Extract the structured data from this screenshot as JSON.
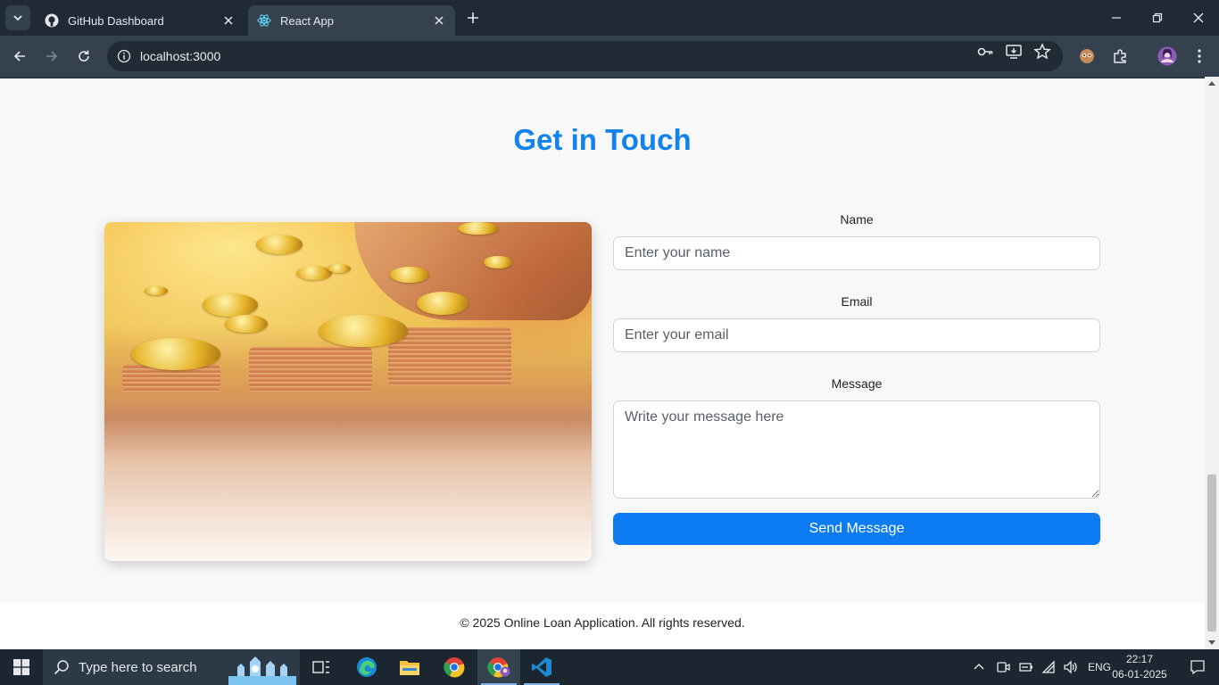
{
  "browser": {
    "tabs": [
      {
        "title": "GitHub Dashboard",
        "favicon": "github-icon"
      },
      {
        "title": "React App",
        "favicon": "react-icon"
      }
    ],
    "url": "localhost:3000"
  },
  "page": {
    "heading": "Get in Touch",
    "image": "coins-stack-photo",
    "form": {
      "name_label": "Name",
      "name_placeholder": "Enter your name",
      "email_label": "Email",
      "email_placeholder": "Enter your email",
      "message_label": "Message",
      "message_placeholder": "Write your message here",
      "submit_label": "Send Message"
    },
    "footer": "© 2025 Online Loan Application. All rights reserved."
  },
  "colors": {
    "accent": "#0d7cf2",
    "heading": "#1283ea",
    "chrome": "#35414e"
  },
  "taskbar": {
    "search_placeholder": "Type here to search",
    "apps": [
      "task-view-icon",
      "edge-icon",
      "file-explorer-icon",
      "chrome-icon",
      "chrome-profile-icon",
      "vscode-icon"
    ],
    "language": "ENG",
    "time": "22:17",
    "date": "06-01-2025"
  }
}
